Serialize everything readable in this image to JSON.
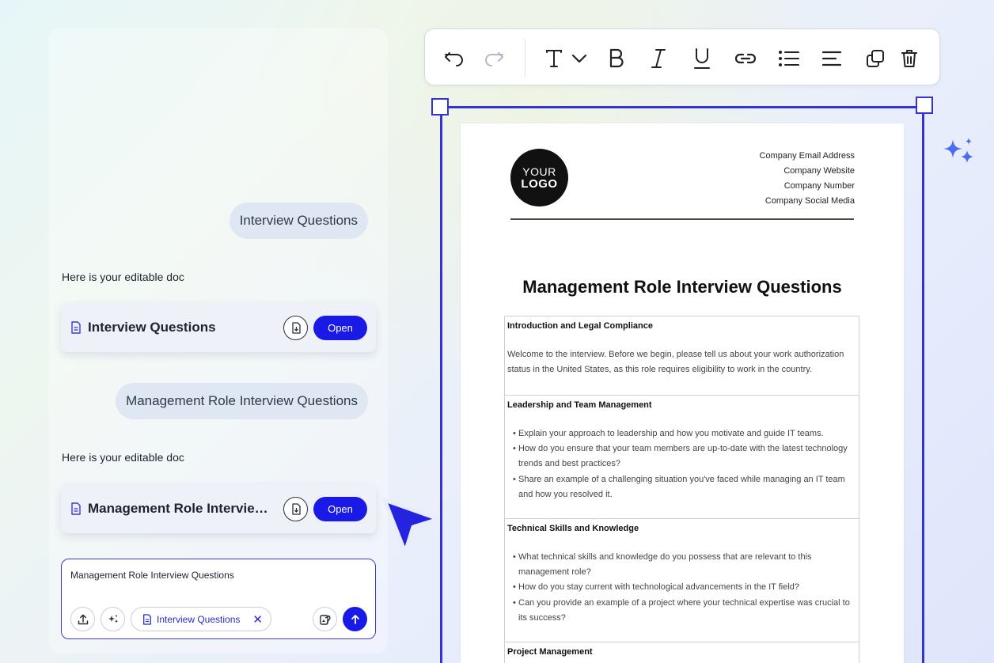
{
  "chat": {
    "messages": [
      {
        "role": "user",
        "text": "Interview Questions"
      },
      {
        "role": "assistant",
        "text": "Here is your editable doc",
        "doc_title": "Interview Questions",
        "open_label": "Open"
      },
      {
        "role": "user",
        "text": "Management Role Interview Questions"
      },
      {
        "role": "assistant",
        "text": "Here is your editable doc",
        "doc_title": "Management Role Interview Questions",
        "open_label": "Open"
      }
    ],
    "composer": {
      "value": "Management Role Interview Questions",
      "attachment_chip": "Interview Questions"
    }
  },
  "toolbar": {
    "icons": [
      "undo-icon",
      "redo-icon",
      "text-style-icon",
      "chevron-down-icon",
      "bold-icon",
      "italic-icon",
      "underline-icon",
      "link-icon",
      "bulleted-list-icon",
      "align-left-icon",
      "duplicate-icon",
      "delete-icon"
    ]
  },
  "document": {
    "logo": {
      "line1": "YOUR",
      "line2": "LOGO"
    },
    "contact": [
      "Company Email Address",
      "Company Website",
      "Company Number",
      "Company Social Media"
    ],
    "title": "Management Role Interview Questions",
    "sections": [
      {
        "title": "Introduction and Legal Compliance",
        "paragraph": "Welcome to the interview. Before we begin, please tell us about your work authorization status in the United States, as this role requires eligibility to work in the country."
      },
      {
        "title": "Leadership and Team Management",
        "bullets": [
          "Explain your approach to leadership and how you motivate and guide IT teams.",
          "How do you ensure that your team members are up-to-date with the latest technology trends and best practices?",
          "Share an example of a challenging situation you've faced while managing an IT team and how you resolved it."
        ]
      },
      {
        "title": "Technical Skills and Knowledge",
        "bullets": [
          "What technical skills and knowledge do you possess that are relevant to this management role?",
          "How do you stay current with technological advancements in the IT field?",
          "Can you provide an example of a project where your technical expertise was crucial to its success?"
        ]
      },
      {
        "title": "Project Management"
      }
    ]
  },
  "colors": {
    "accent": "#1a1ae6",
    "selection": "#3434d6",
    "bubble": "#dfe7f3",
    "sparkle": "#4a6cf0"
  }
}
